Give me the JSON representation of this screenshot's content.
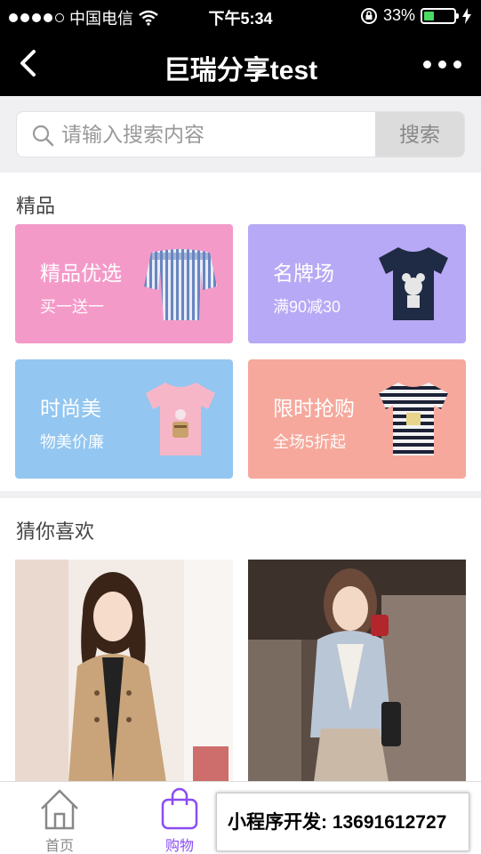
{
  "status_bar": {
    "carrier": "中国电信",
    "time": "下午5:34",
    "battery": "33%",
    "battery_level": 0.33
  },
  "nav": {
    "title": "巨瑞分享test"
  },
  "search": {
    "placeholder": "请输入搜索内容",
    "button_label": "搜索"
  },
  "featured": {
    "header": "精品",
    "cards": [
      {
        "title": "精品优选",
        "subtitle": "买一送一",
        "color": "#f49ac9"
      },
      {
        "title": "名牌场",
        "subtitle": "满90减30",
        "color": "#b7a9f5"
      },
      {
        "title": "时尚美",
        "subtitle": "物美价廉",
        "color": "#93c6f0"
      },
      {
        "title": "限时抢购",
        "subtitle": "全场5折起",
        "color": "#f6a89c"
      }
    ]
  },
  "recommend": {
    "header": "猜你喜欢"
  },
  "tabbar": {
    "items": [
      {
        "label": "首页"
      },
      {
        "label": "购物"
      }
    ],
    "active_color": "#8a4df2"
  },
  "overlay": {
    "text": "小程序开发: 13691612727"
  }
}
